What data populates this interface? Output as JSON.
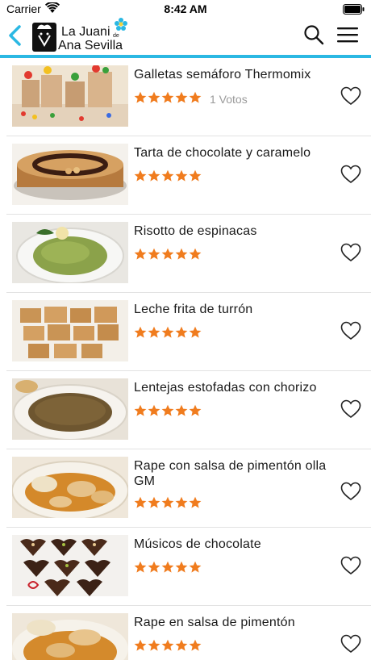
{
  "status_bar": {
    "carrier": "Carrier",
    "time": "8:42 AM"
  },
  "nav": {
    "logo_text": [
      "La Juani",
      "Ana Sevilla"
    ],
    "logo_small": "de",
    "accent_color": "#2bb8e3"
  },
  "colors": {
    "star": "#f07c1e",
    "votes": "#9a9a9a",
    "divider": "#e2e2e2"
  },
  "recipes": [
    {
      "title": "Galletas semáforo Thermomix",
      "votes": "1 Votos",
      "rating": 5
    },
    {
      "title": "Tarta de chocolate y caramelo",
      "votes": "",
      "rating": 5
    },
    {
      "title": "Risotto de espinacas",
      "votes": "",
      "rating": 5
    },
    {
      "title": "Leche frita de turrón",
      "votes": "",
      "rating": 5
    },
    {
      "title": "Lentejas estofadas con chorizo",
      "votes": "",
      "rating": 5
    },
    {
      "title": "Rape con salsa de pimentón olla GM",
      "votes": "",
      "rating": 5
    },
    {
      "title": "Músicos de chocolate",
      "votes": "",
      "rating": 5
    },
    {
      "title": "Rape en salsa de pimentón",
      "votes": "",
      "rating": 5
    }
  ]
}
